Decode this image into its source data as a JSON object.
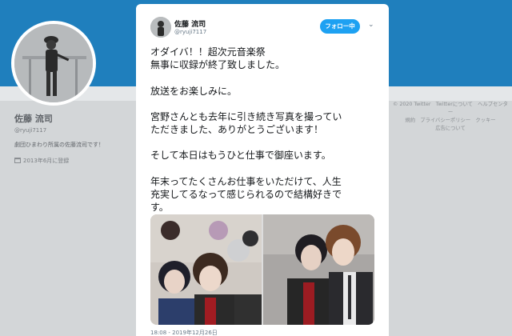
{
  "profile": {
    "name": "佐藤 流司",
    "handle": "@ryuji7117",
    "bio": "劇団ひまわり所属の佐藤流司です！",
    "joined": "2013年6月に登録"
  },
  "footer": {
    "line1": "© 2020 Twitter　Twitterについて　ヘルプセンター",
    "line2": "規約　プライバシーポリシー　クッキー",
    "line3": "広告について"
  },
  "tweet": {
    "author_name": "佐藤 流司",
    "author_handle": "@ryuji7117",
    "follow_label": "フォロー中",
    "lines": [
      "オダイバ！！超次元音楽祭",
      "無事に収録が終了致しました。",
      "",
      "放送をお楽しみに。",
      "",
      "宮野さんとも去年に引き続き写真を撮ってい",
      "ただきました、ありがとうございます！",
      "",
      "そして本日はもうひと仕事で御座います。",
      "",
      "年末ってたくさんお仕事をいただけて、人生",
      "充実してるなって感じられるので結構好きで",
      "す。"
    ],
    "timestamp": "18:08 - 2019年12月26日"
  },
  "colors": {
    "banner": "#1f7fbd",
    "follow_button": "#1da1f2"
  },
  "icons": {
    "calendar": "calendar-icon",
    "caret": "chevron-down-icon"
  }
}
